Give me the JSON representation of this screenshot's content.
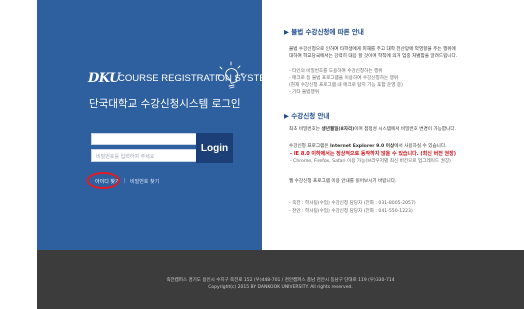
{
  "left": {
    "logo": "DKU",
    "system_name": "COURSE REGISTRATION SYSTEM",
    "title": "단국대학교 수강신청시스템 로그인",
    "id_input": {
      "value": "",
      "placeholder": ""
    },
    "pw_input": {
      "placeholder": "비밀번호를 입력하여 주세요"
    },
    "login_label": "Login",
    "id_find_label": "아이디 찾기",
    "separator": "|",
    "pw_find_label": "비밀번호 찾기"
  },
  "right": {
    "notice1": {
      "title": "▶ 불법 수강신청에 따른 안내",
      "p1": "불법 수강신청으로 인하여 타학생에게 피해를 주고 대학 전산망에 악영향을 주는 행위에",
      "p2": "대하여 학교당국에서는 강력히 대응 할 것이며 학칙에 의거 엄중 처벌함을 알려드립니다.",
      "bullets": [
        "- 타인의 비밀번호를 도용하여 수강신청하는 행위",
        "- 매크로 등 불법 프로그램을 이용하여 수강신청하는 행위",
        "  (현재 수강신청 프로그램 내 매크로 탐지 기능 포함 운영 중)",
        "- 기타 불법행위"
      ]
    },
    "notice2": {
      "title": "▶ 수강신청 안내",
      "line1_pre": "최초 비밀번호는 ",
      "line1_bold": "생년월일(8자리)",
      "line1_post": "이며 접정성 시스템에서 비밀번호 변경이 가능합니다.",
      "line2_pre": "수강신청 프로그램은 ",
      "line2_bold": "Internet Explorer 9.0 이상",
      "line2_post": "에서 사용하실 수 있습니다.",
      "warning": "- IE 8.0 이하에서는 정상적으로 동작하지 않을 수 있습니다. (최신 버전 권장)",
      "browsers": "- Chrome, Firefox, Safari 이용 가능(브라우저별 최신 버전으로 업그레이드 권장)",
      "guide": "웹 수강신청 프로그램 이용 안내를 읽어보시기 바랍니다.",
      "contact1": "- 죽전 : 학사팀(수업) 수강신청 담당자 (전화 : 031-8005-2057)",
      "contact2": "- 천안 : 학사팀(수업) 수강신청 담당자 (전화 : 041-550-1223)"
    }
  },
  "footer": {
    "address": "죽전캠퍼스 경기도 용인시 수지구 죽전로 152 (우)448-701 / 천안캠퍼스 충남 천안시 동남구 단대로 119 (우)330-714",
    "copyright": "Copyright(c) 2015 BY DANKOOK UNIVERSITY. All rights reserved."
  },
  "colors": {
    "panel": "#2e5f9e",
    "login_button": "#1c3f78",
    "footer": "#3c3c3c",
    "highlight_circle": "#e31b23",
    "warning_text": "#d0121b"
  },
  "icons": [
    "lightbulb-icon"
  ]
}
